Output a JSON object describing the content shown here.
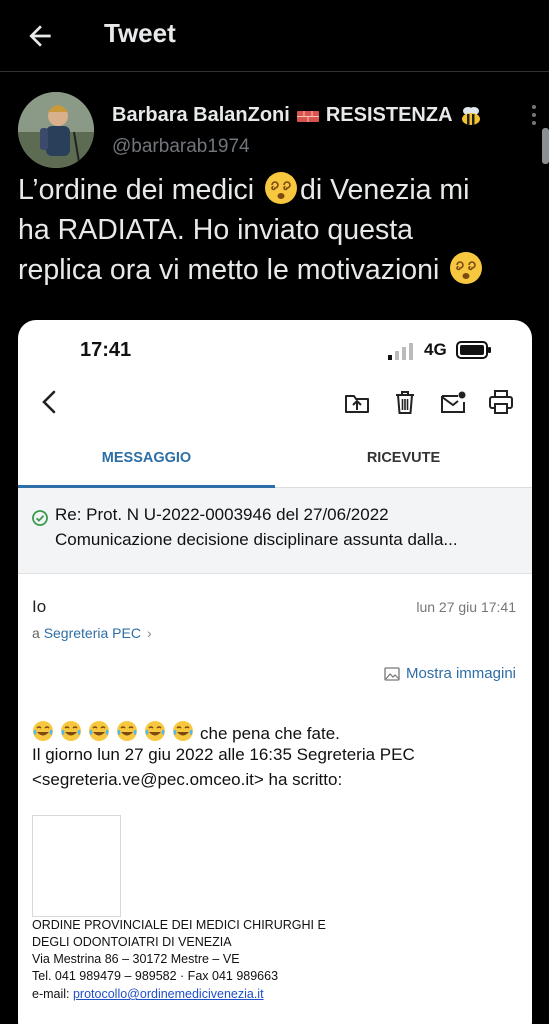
{
  "header": {
    "title": "Tweet"
  },
  "author": {
    "name": "Barbara BalanZoni",
    "name_suffix": "RESISTENZA",
    "handle": "@barbarab1974"
  },
  "tweet": {
    "line1_a": "L’ordine dei medici ",
    "line1_b": "di Venezia mi",
    "line2": "ha RADIATA. Ho inviato questa",
    "line3": "replica ora vi metto le motivazioni "
  },
  "screenshot": {
    "status": {
      "time": "17:41",
      "network": "4G"
    },
    "tabs": [
      {
        "label": "MESSAGGIO"
      },
      {
        "label": "RICEVUTE"
      }
    ],
    "subject_line1": "Re: Prot. N U-2022-0003946 del 27/06/2022",
    "subject_line2": "Comunicazione decisione disciplinare assunta dalla...",
    "from": "Io",
    "date": "lun 27 giu 17:41",
    "to_prefix": "a",
    "to_name": "Segreteria PEC",
    "to_chevron": "›",
    "show_images": "Mostra immagini",
    "body_line1": "che pena che fate.",
    "body_line2": "Il giorno lun 27 giu 2022 alle 16:35 Segreteria PEC",
    "body_line3": "<segreteria.ve@pec.omceo.it> ha scritto:",
    "org_line1": "ORDINE PROVINCIALE DEI MEDICI CHIRURGHI E",
    "org_line2": "DEGLI ODONTOIATRI  DI VENEZIA",
    "org_line3": "Via Mestrina 86 – 30172 Mestre – VE",
    "org_line4": "Tel. 041 989479 – 989582 · Fax 041 989663",
    "org_email_label": "e-mail:  ",
    "org_email": "protocollo@ordinemedicivenezia.it"
  },
  "icons": {
    "back": "back-arrow-icon",
    "more": "more-vertical-icon",
    "emoji_tweet": "dizzy-face-emoji",
    "emoji_body": "tears-of-joy-emoji"
  },
  "colors": {
    "background": "#000000",
    "text": "#e7e9ea",
    "muted": "#71767b",
    "link": "#2d6ea6"
  }
}
